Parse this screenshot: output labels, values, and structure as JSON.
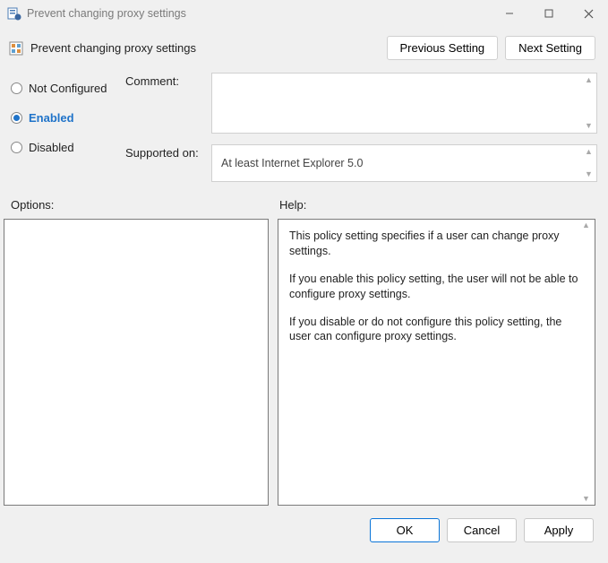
{
  "window": {
    "title": "Prevent changing proxy settings"
  },
  "header": {
    "policy_title": "Prevent changing proxy settings",
    "prev_btn": "Previous Setting",
    "next_btn": "Next Setting"
  },
  "radios": {
    "not_configured": "Not Configured",
    "enabled": "Enabled",
    "disabled": "Disabled",
    "selected": "enabled"
  },
  "fields": {
    "comment_label": "Comment:",
    "comment_value": "",
    "supported_label": "Supported on:",
    "supported_value": "At least Internet Explorer 5.0"
  },
  "sections": {
    "options_label": "Options:",
    "help_label": "Help:"
  },
  "help": {
    "p1": "This policy setting specifies if a user can change proxy settings.",
    "p2": "If you enable this policy setting, the user will not be able to configure proxy settings.",
    "p3": "If you disable or do not configure this policy setting, the user can configure proxy settings."
  },
  "footer": {
    "ok": "OK",
    "cancel": "Cancel",
    "apply": "Apply"
  }
}
